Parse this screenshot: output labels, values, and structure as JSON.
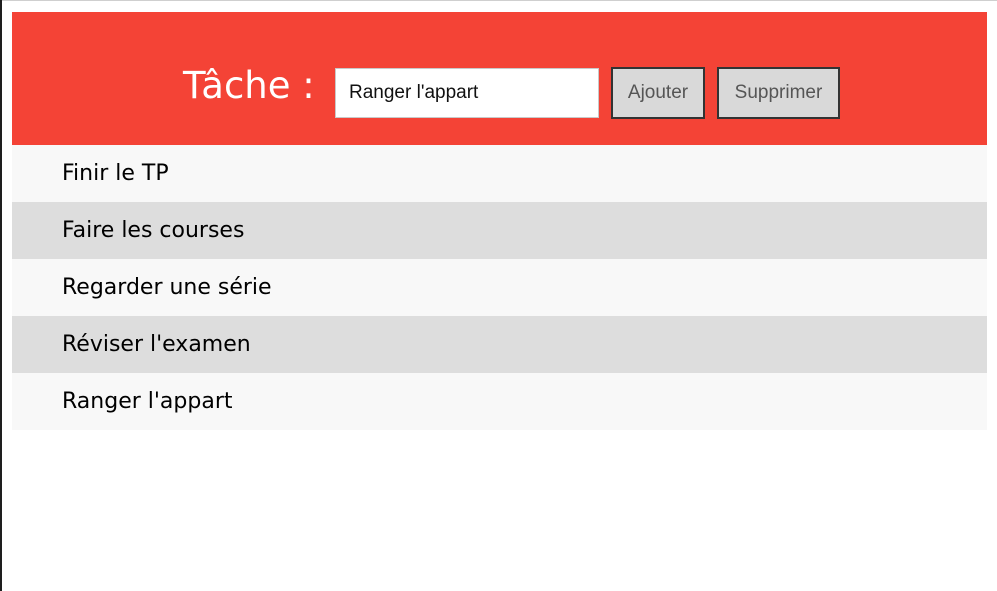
{
  "header": {
    "label": "Tâche :",
    "input_value": "Ranger l'appart",
    "add_button": "Ajouter",
    "delete_button": "Supprimer"
  },
  "tasks": [
    "Finir le TP",
    "Faire les courses",
    "Regarder une série",
    "Réviser l'examen",
    "Ranger l'appart"
  ],
  "colors": {
    "header_background": "#f44336",
    "row_odd": "#f8f8f8",
    "row_even": "#dddddd",
    "button_background": "#d9d9d9"
  }
}
